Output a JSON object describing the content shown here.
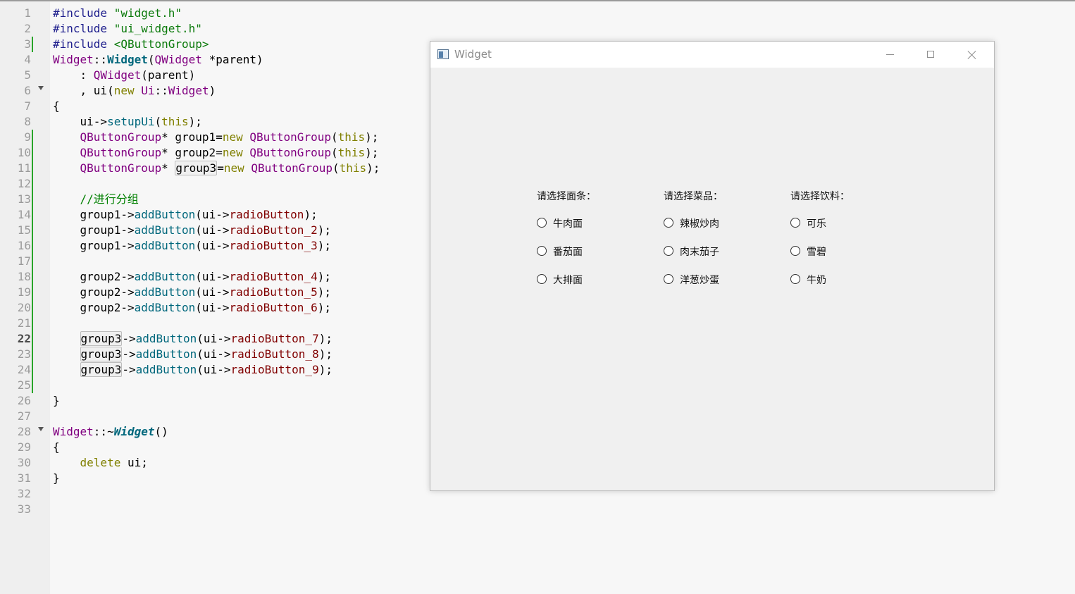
{
  "editor": {
    "current_line": 22,
    "lines": [
      {
        "n": "1",
        "fold": false,
        "mark": false
      },
      {
        "n": "2",
        "fold": false,
        "mark": false
      },
      {
        "n": "3",
        "fold": false,
        "mark": true
      },
      {
        "n": "4",
        "fold": false,
        "mark": false
      },
      {
        "n": "5",
        "fold": false,
        "mark": false
      },
      {
        "n": "6",
        "fold": true,
        "mark": false
      },
      {
        "n": "7",
        "fold": false,
        "mark": false
      },
      {
        "n": "8",
        "fold": false,
        "mark": false
      },
      {
        "n": "9",
        "fold": false,
        "mark": true
      },
      {
        "n": "10",
        "fold": false,
        "mark": true
      },
      {
        "n": "11",
        "fold": false,
        "mark": true
      },
      {
        "n": "12",
        "fold": false,
        "mark": true
      },
      {
        "n": "13",
        "fold": false,
        "mark": true
      },
      {
        "n": "14",
        "fold": false,
        "mark": true
      },
      {
        "n": "15",
        "fold": false,
        "mark": true
      },
      {
        "n": "16",
        "fold": false,
        "mark": true
      },
      {
        "n": "17",
        "fold": false,
        "mark": true
      },
      {
        "n": "18",
        "fold": false,
        "mark": true
      },
      {
        "n": "19",
        "fold": false,
        "mark": true
      },
      {
        "n": "20",
        "fold": false,
        "mark": true
      },
      {
        "n": "21",
        "fold": false,
        "mark": true
      },
      {
        "n": "22",
        "fold": false,
        "mark": true
      },
      {
        "n": "23",
        "fold": false,
        "mark": true
      },
      {
        "n": "24",
        "fold": false,
        "mark": true
      },
      {
        "n": "25",
        "fold": false,
        "mark": true
      },
      {
        "n": "26",
        "fold": false,
        "mark": false
      },
      {
        "n": "27",
        "fold": false,
        "mark": false
      },
      {
        "n": "28",
        "fold": true,
        "mark": false
      },
      {
        "n": "29",
        "fold": false,
        "mark": false
      },
      {
        "n": "30",
        "fold": false,
        "mark": false
      },
      {
        "n": "31",
        "fold": false,
        "mark": false
      },
      {
        "n": "32",
        "fold": false,
        "mark": false
      },
      {
        "n": "33",
        "fold": false,
        "mark": false
      }
    ],
    "code": [
      [
        [
          "pp",
          "#include "
        ],
        [
          "str",
          "\"widget.h\""
        ]
      ],
      [
        [
          "pp",
          "#include "
        ],
        [
          "str",
          "\"ui_widget.h\""
        ]
      ],
      [
        [
          "pp",
          "#include "
        ],
        [
          "inc",
          "<QButtonGroup>"
        ]
      ],
      [
        [
          "cls",
          "Widget"
        ],
        [
          "",
          "::"
        ],
        [
          "fnb",
          "Widget"
        ],
        [
          "",
          "("
        ],
        [
          "cls",
          "QWidget"
        ],
        [
          "",
          " *parent)"
        ]
      ],
      [
        [
          "",
          "    : "
        ],
        [
          "cls",
          "QWidget"
        ],
        [
          "",
          "(parent)"
        ]
      ],
      [
        [
          "",
          "    , ui("
        ],
        [
          "kw",
          "new"
        ],
        [
          "",
          " "
        ],
        [
          "cls",
          "Ui"
        ],
        [
          "",
          "::"
        ],
        [
          "cls",
          "Widget"
        ],
        [
          "",
          ")"
        ]
      ],
      [
        [
          "",
          "{"
        ]
      ],
      [
        [
          "",
          "    ui->"
        ],
        [
          "fn",
          "setupUi"
        ],
        [
          "",
          "("
        ],
        [
          "kw",
          "this"
        ],
        [
          "",
          ");"
        ]
      ],
      [
        [
          "",
          "    "
        ],
        [
          "typ",
          "QButtonGroup"
        ],
        [
          "",
          "* group1="
        ],
        [
          "kw",
          "new"
        ],
        [
          "",
          " "
        ],
        [
          "cls",
          "QButtonGroup"
        ],
        [
          "",
          "("
        ],
        [
          "kw",
          "this"
        ],
        [
          "",
          ");"
        ]
      ],
      [
        [
          "",
          "    "
        ],
        [
          "typ",
          "QButtonGroup"
        ],
        [
          "",
          "* group2="
        ],
        [
          "kw",
          "new"
        ],
        [
          "",
          " "
        ],
        [
          "cls",
          "QButtonGroup"
        ],
        [
          "",
          "("
        ],
        [
          "kw",
          "this"
        ],
        [
          "",
          ");"
        ]
      ],
      [
        [
          "",
          "    "
        ],
        [
          "typ",
          "QButtonGroup"
        ],
        [
          "",
          "* "
        ],
        [
          "hl",
          "group3"
        ],
        [
          "",
          "="
        ],
        [
          "kw",
          "new"
        ],
        [
          "",
          " "
        ],
        [
          "cls",
          "QButtonGroup"
        ],
        [
          "",
          "("
        ],
        [
          "kw",
          "this"
        ],
        [
          "",
          ");"
        ]
      ],
      [
        [
          "",
          ""
        ]
      ],
      [
        [
          "",
          "    "
        ],
        [
          "cm",
          "//进行分组"
        ]
      ],
      [
        [
          "",
          "    group1->"
        ],
        [
          "fn",
          "addButton"
        ],
        [
          "",
          "(ui->"
        ],
        [
          "mem",
          "radioButton"
        ],
        [
          "",
          ");"
        ]
      ],
      [
        [
          "",
          "    group1->"
        ],
        [
          "fn",
          "addButton"
        ],
        [
          "",
          "(ui->"
        ],
        [
          "mem",
          "radioButton_2"
        ],
        [
          "",
          ");"
        ]
      ],
      [
        [
          "",
          "    group1->"
        ],
        [
          "fn",
          "addButton"
        ],
        [
          "",
          "(ui->"
        ],
        [
          "mem",
          "radioButton_3"
        ],
        [
          "",
          ");"
        ]
      ],
      [
        [
          "",
          ""
        ]
      ],
      [
        [
          "",
          "    group2->"
        ],
        [
          "fn",
          "addButton"
        ],
        [
          "",
          "(ui->"
        ],
        [
          "mem",
          "radioButton_4"
        ],
        [
          "",
          ");"
        ]
      ],
      [
        [
          "",
          "    group2->"
        ],
        [
          "fn",
          "addButton"
        ],
        [
          "",
          "(ui->"
        ],
        [
          "mem",
          "radioButton_5"
        ],
        [
          "",
          ");"
        ]
      ],
      [
        [
          "",
          "    group2->"
        ],
        [
          "fn",
          "addButton"
        ],
        [
          "",
          "(ui->"
        ],
        [
          "mem",
          "radioButton_6"
        ],
        [
          "",
          ");"
        ]
      ],
      [
        [
          "",
          ""
        ]
      ],
      [
        [
          "",
          "    "
        ],
        [
          "hl",
          "group3"
        ],
        [
          "",
          "->"
        ],
        [
          "fn",
          "addButton"
        ],
        [
          "",
          "(ui->"
        ],
        [
          "mem",
          "radioButton_7"
        ],
        [
          "",
          ");"
        ]
      ],
      [
        [
          "",
          "    "
        ],
        [
          "hl",
          "group3"
        ],
        [
          "",
          "->"
        ],
        [
          "fn",
          "addButton"
        ],
        [
          "",
          "(ui->"
        ],
        [
          "mem",
          "radioButton_8"
        ],
        [
          "",
          ");"
        ]
      ],
      [
        [
          "",
          "    "
        ],
        [
          "hl",
          "group3"
        ],
        [
          "",
          "->"
        ],
        [
          "fn",
          "addButton"
        ],
        [
          "",
          "(ui->"
        ],
        [
          "mem",
          "radioButton_9"
        ],
        [
          "",
          ");"
        ]
      ],
      [
        [
          "",
          ""
        ]
      ],
      [
        [
          "",
          "}"
        ]
      ],
      [
        [
          "",
          ""
        ]
      ],
      [
        [
          "cls",
          "Widget"
        ],
        [
          "",
          "::~"
        ],
        [
          "fni",
          "Widget"
        ],
        [
          "",
          "()"
        ]
      ],
      [
        [
          "",
          "{"
        ]
      ],
      [
        [
          "",
          "    "
        ],
        [
          "kw",
          "delete"
        ],
        [
          "",
          " ui;"
        ]
      ],
      [
        [
          "",
          "}"
        ]
      ],
      [
        [
          "",
          ""
        ]
      ],
      [
        [
          "",
          ""
        ]
      ]
    ]
  },
  "window": {
    "title": "Widget",
    "groups": [
      {
        "label": "请选择面条：",
        "options": [
          "牛肉面",
          "番茄面",
          "大排面"
        ]
      },
      {
        "label": "请选择菜品：",
        "options": [
          "辣椒炒肉",
          "肉末茄子",
          "洋葱炒蛋"
        ]
      },
      {
        "label": "请选择饮料：",
        "options": [
          "可乐",
          "雪碧",
          "牛奶"
        ]
      }
    ]
  }
}
